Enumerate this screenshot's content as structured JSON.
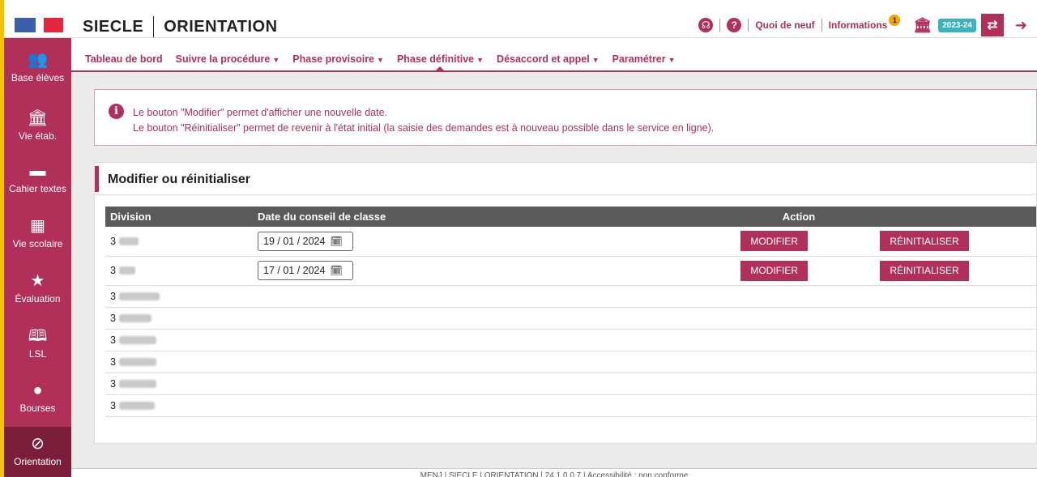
{
  "header": {
    "app_name": "SIECLE",
    "module_name": "ORIENTATION",
    "links": [
      "Quoi de neuf",
      "Informations"
    ],
    "info_count": "1",
    "year": "2023-24"
  },
  "sidebar": {
    "items": [
      {
        "label": "Base élèves",
        "icon": "users-icon"
      },
      {
        "label": "Vie étab.",
        "icon": "building-icon"
      },
      {
        "label": "Cahier textes",
        "icon": "book-icon"
      },
      {
        "label": "Vie scolaire",
        "icon": "calendar-icon"
      },
      {
        "label": "Évaluation",
        "icon": "star-icon"
      },
      {
        "label": "LSL",
        "icon": "open-book-icon"
      },
      {
        "label": "Bourses",
        "icon": "purse-icon"
      },
      {
        "label": "Orientation",
        "icon": "compass-icon",
        "active": true
      }
    ]
  },
  "nav": {
    "items": [
      {
        "label": "Tableau de bord",
        "dropdown": false
      },
      {
        "label": "Suivre la procédure",
        "dropdown": true
      },
      {
        "label": "Phase provisoire",
        "dropdown": true
      },
      {
        "label": "Phase définitive",
        "dropdown": true,
        "active": true
      },
      {
        "label": "Désaccord et appel",
        "dropdown": true
      },
      {
        "label": "Paramétrer",
        "dropdown": true
      }
    ]
  },
  "info": {
    "line1": "Le bouton \"Modifier\" permet d'afficher une nouvelle date.",
    "line2": "Le bouton \"Réinitialiser\" permet de revenir à l'état initial (la saisie des demandes est à nouveau possible dans le service en ligne)."
  },
  "panel": {
    "title": "Modifier ou réinitialiser",
    "columns": {
      "division": "Division",
      "date": "Date du conseil de classe",
      "action": "Action"
    },
    "modify_label": "MODIFIER",
    "reset_label": "RÉINITIALISER",
    "rows": [
      {
        "division": "3",
        "date": "19 / 01 / 2024"
      },
      {
        "division": "3",
        "date": "17 / 01 / 2024"
      },
      {
        "division": "3"
      },
      {
        "division": "3"
      },
      {
        "division": "3"
      },
      {
        "division": "3"
      },
      {
        "division": "3"
      },
      {
        "division": "3"
      }
    ]
  },
  "footer": {
    "text": "MENJ | SIECLE | ORIENTATION | 24.1.0.0.7 | Accessibilité : non conforme"
  }
}
